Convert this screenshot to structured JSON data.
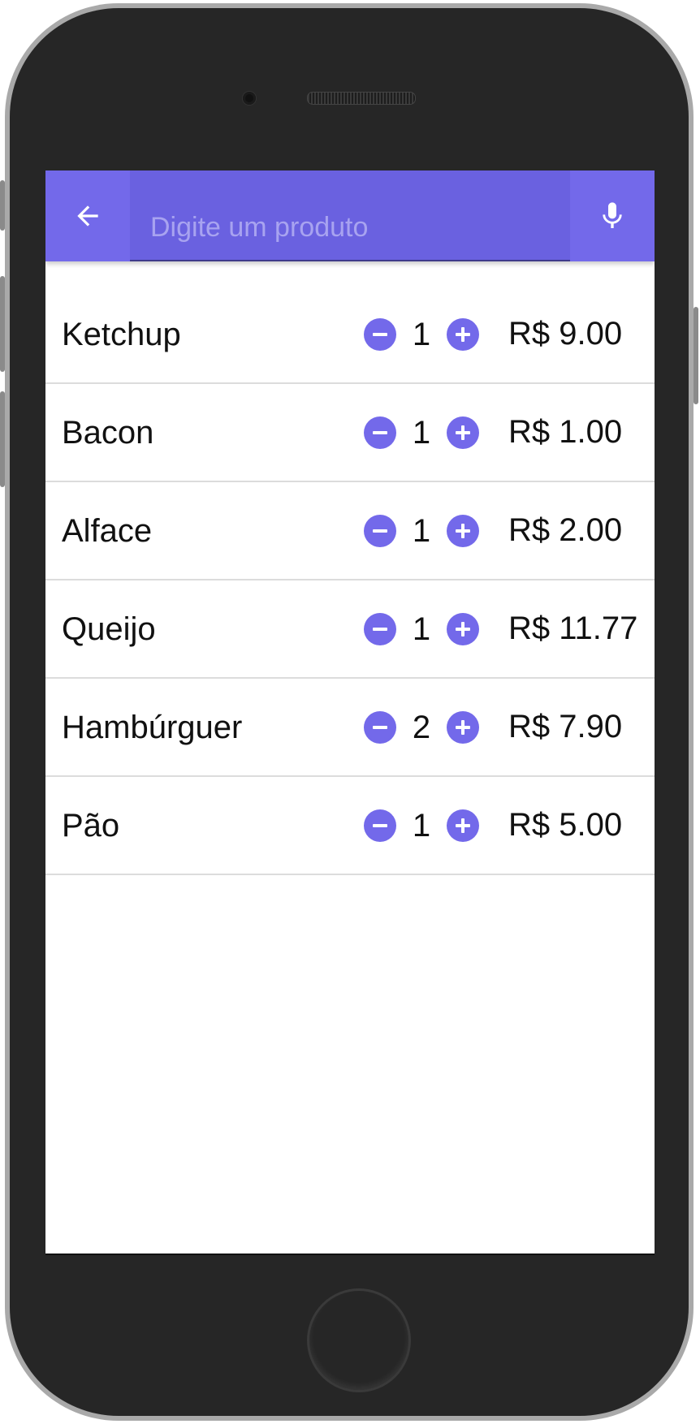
{
  "search": {
    "placeholder": "Digite um produto",
    "value": ""
  },
  "icons": {
    "back": "arrow-back-icon",
    "mic": "microphone-icon",
    "decrement": "minus-circle-icon",
    "increment": "plus-circle-icon"
  },
  "colors": {
    "primary": "#7369ea",
    "search_field_bg": "#6a61e0",
    "device_body": "#262626",
    "divider": "#dcdcdc"
  },
  "items": [
    {
      "name": "Ketchup",
      "quantity": "1",
      "price": "R$ 9.00"
    },
    {
      "name": "Bacon",
      "quantity": "1",
      "price": "R$ 1.00"
    },
    {
      "name": "Alface",
      "quantity": "1",
      "price": "R$ 2.00"
    },
    {
      "name": "Queijo",
      "quantity": "1",
      "price": "R$ 11.77"
    },
    {
      "name": "Hambúrguer",
      "quantity": "2",
      "price": "R$ 7.90"
    },
    {
      "name": "Pão",
      "quantity": "1",
      "price": "R$ 5.00"
    }
  ]
}
